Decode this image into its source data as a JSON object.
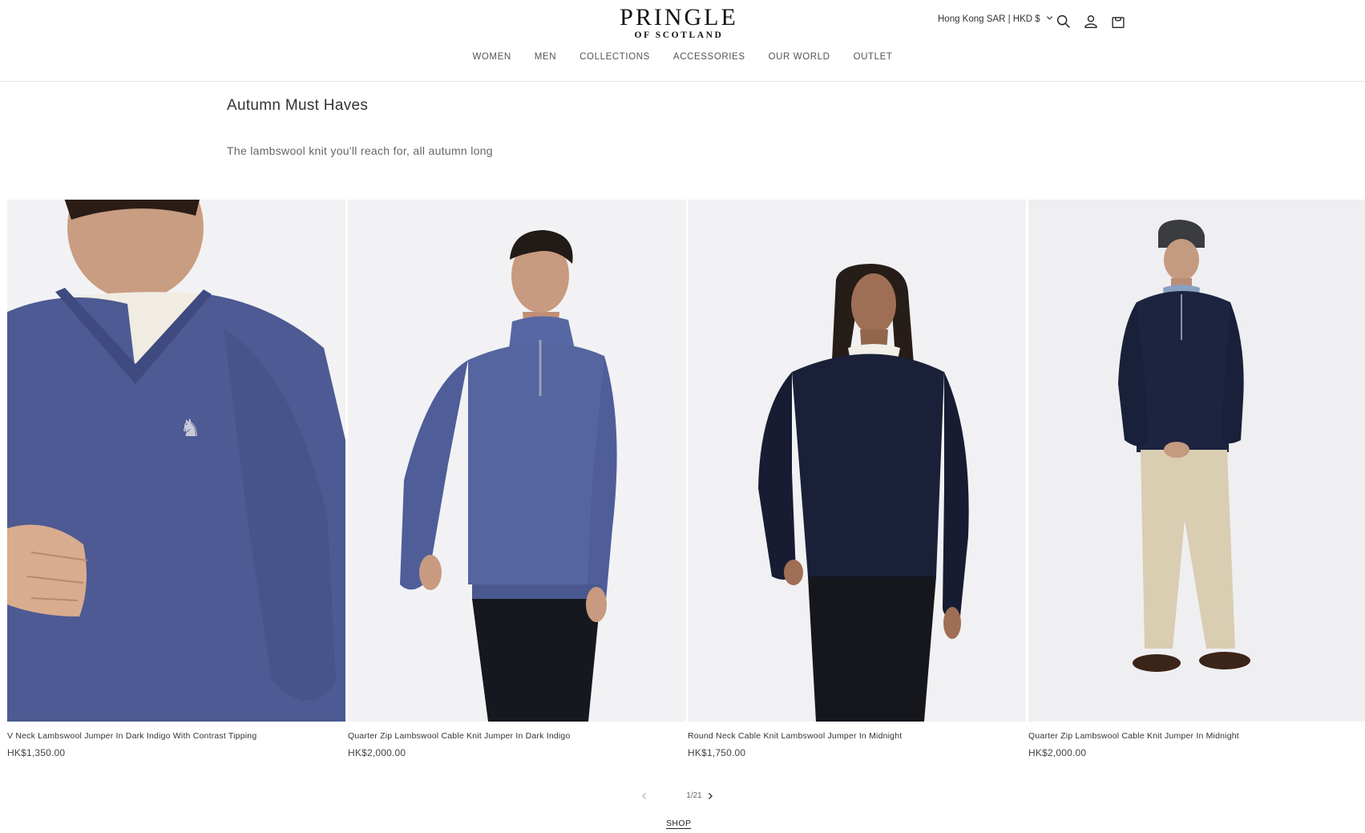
{
  "brand": {
    "name": "PRINGLE",
    "sub": "OF SCOTLAND"
  },
  "header": {
    "locale_label": "Hong Kong SAR | HKD $",
    "icons": [
      "search-icon",
      "account-icon",
      "cart-icon"
    ]
  },
  "nav": {
    "items": [
      "WOMEN",
      "MEN",
      "COLLECTIONS",
      "ACCESSORIES",
      "OUR WORLD",
      "OUTLET"
    ]
  },
  "section": {
    "title": "Autumn Must Haves",
    "subtitle": "The lambswool knit you'll reach for, all autumn long"
  },
  "products": [
    {
      "name": "V Neck Lambswool Jumper In Dark Indigo With Contrast Tipping",
      "price": "HK$1,350.00",
      "color": "#4d5a93"
    },
    {
      "name": "Quarter Zip Lambswool Cable Knit Jumper In Dark Indigo",
      "price": "HK$2,000.00",
      "color": "#5565a0"
    },
    {
      "name": "Round Neck Cable Knit Lambswool Jumper In Midnight",
      "price": "HK$1,750.00",
      "color": "#1a2038"
    },
    {
      "name": "Quarter Zip Lambswool Cable Knit Jumper In Midnight",
      "price": "HK$2,000.00",
      "color": "#1c2440"
    }
  ],
  "carousel": {
    "counter": "1/21"
  },
  "shop_link": "SHOP"
}
